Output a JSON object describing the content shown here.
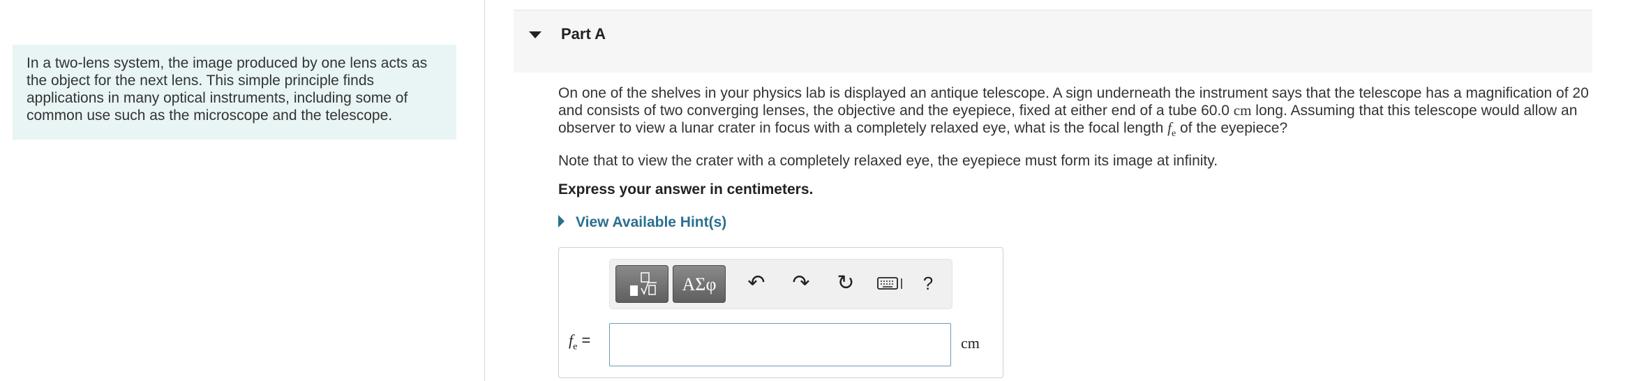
{
  "intro": {
    "text": "In a two-lens system, the image produced by one lens acts as the object for the next lens. This simple principle finds applications in many optical instruments, including some of common use such as the microscope and the telescope."
  },
  "part": {
    "title": "Part A"
  },
  "question": {
    "text_1": "On one of the shelves in your physics lab is displayed an antique telescope. A sign underneath the instrument says that the telescope has a magnification of 20 and consists of two converging lenses, the objective and the eyepiece, fixed at either end of a tube 60.0 ",
    "unit_1": "cm",
    "text_2": " long. Assuming that this telescope would allow an observer to view a lunar crater in focus with a completely relaxed eye, what is the focal length ",
    "var": "f",
    "var_sub": "e",
    "text_3": " of the eyepiece?"
  },
  "note": "Note that to view the crater with a completely relaxed eye, the eyepiece must form its image at infinity.",
  "express": "Express your answer in centimeters.",
  "hint": {
    "label": "View Available Hint(s)"
  },
  "toolbar": {
    "symbols_label": "ΑΣφ",
    "undo": "↶",
    "redo": "↷",
    "reset": "↻",
    "help": "?"
  },
  "answer": {
    "var": "f",
    "var_sub": "e",
    "equals": " =",
    "value": "",
    "unit": "cm"
  }
}
